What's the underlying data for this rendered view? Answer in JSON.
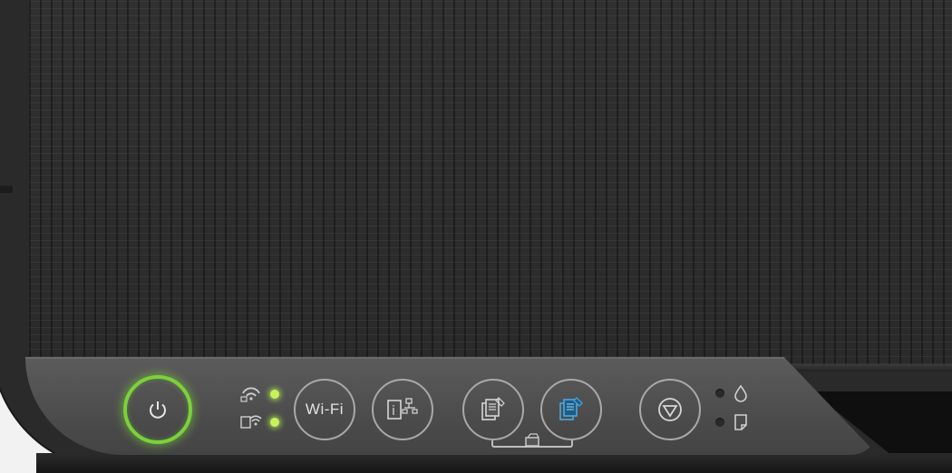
{
  "panel": {
    "wifi_label": "Wi-Fi",
    "leds": {
      "wifi_status": "on",
      "wifi_direct_status": "on",
      "ink_status": "off",
      "paper_status": "off"
    }
  },
  "colors": {
    "power_ring": "#7bd13a",
    "led_on": "#c8f05a",
    "copy_color_accent": "#4aa8e0",
    "panel_gray": "#555555"
  },
  "icons": {
    "power": "power-icon",
    "wifi_status": "wifi-icon",
    "wifi_direct_status": "wifi-direct-icon",
    "info": "network-info-icon",
    "copy_bw": "bw-copy-icon",
    "copy_color": "color-copy-icon",
    "stop": "stop-icon",
    "ink": "ink-drop-icon",
    "paper": "paper-icon",
    "copy_tray": "paper-tray-icon"
  }
}
